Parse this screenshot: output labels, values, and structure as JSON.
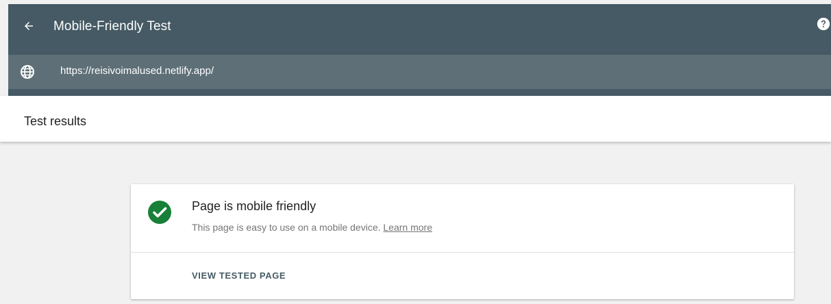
{
  "header": {
    "title": "Mobile-Friendly Test",
    "back_icon": "arrow-back-icon",
    "help_icon": "help-icon",
    "background": "#455a64"
  },
  "url_bar": {
    "icon": "globe-icon",
    "url": "https://reisivoimalused.netlify.app/",
    "background": "#5e6f77"
  },
  "results": {
    "title": "Test results"
  },
  "result_card": {
    "status_icon": "check-circle-icon",
    "status_color": "#188038",
    "title": "Page is mobile friendly",
    "description": "This page is easy to use on a mobile device.",
    "learn_more": "Learn more",
    "view_button": "VIEW TESTED PAGE"
  }
}
